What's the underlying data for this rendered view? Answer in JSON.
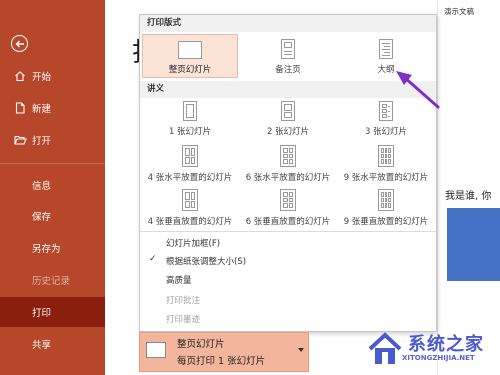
{
  "window_title": "演示文稿",
  "background_title": "打",
  "slide_text": "我是谁, 你",
  "sidebar": {
    "items": [
      {
        "label": "开始",
        "icon": "home-icon"
      },
      {
        "label": "新建",
        "icon": "new-file-icon"
      },
      {
        "label": "打开",
        "icon": "folder-open-icon"
      },
      {
        "label": "信息"
      },
      {
        "label": "保存"
      },
      {
        "label": "另存为"
      },
      {
        "label": "历史记录"
      },
      {
        "label": "打印"
      },
      {
        "label": "共享"
      }
    ],
    "active": "打印",
    "dimmed": "历史记录"
  },
  "dropdown": {
    "section_layout": "打印版式",
    "layout_options": [
      {
        "label": "整页幻灯片",
        "selected": true
      },
      {
        "label": "备注页",
        "selected": false
      },
      {
        "label": "大纲",
        "selected": false
      }
    ],
    "section_handouts": "讲义",
    "handout_options": [
      "1 张幻灯片",
      "2 张幻灯片",
      "3 张幻灯片",
      "4 张水平放置的幻灯片",
      "6 张水平放置的幻灯片",
      "9 张水平放置的幻灯片",
      "4 张垂直放置的幻灯片",
      "6 张垂直放置的幻灯片",
      "9 张垂直放置的幻灯片"
    ],
    "menu_items": [
      {
        "label": "幻灯片加框(F)",
        "checked": false,
        "enabled": true
      },
      {
        "label": "根据纸张调整大小(S)",
        "checked": true,
        "enabled": true
      },
      {
        "label": "高质量",
        "checked": false,
        "enabled": true
      },
      {
        "label": "打印批注",
        "checked": false,
        "enabled": false
      },
      {
        "label": "打印墨迹",
        "checked": false,
        "enabled": false
      }
    ]
  },
  "selector": {
    "line1": "整页幻灯片",
    "line2": "每页打印 1 张幻灯片"
  },
  "watermark": {
    "main": "系统之家",
    "sub": "XITONGZHIJIA.NET"
  },
  "colors": {
    "sidebar": "#b7472a",
    "active": "#8b1e0c",
    "selected_option": "#fbe3d8",
    "selector": "#f3b69c",
    "annotation_arrow": "#7e2fc9"
  }
}
